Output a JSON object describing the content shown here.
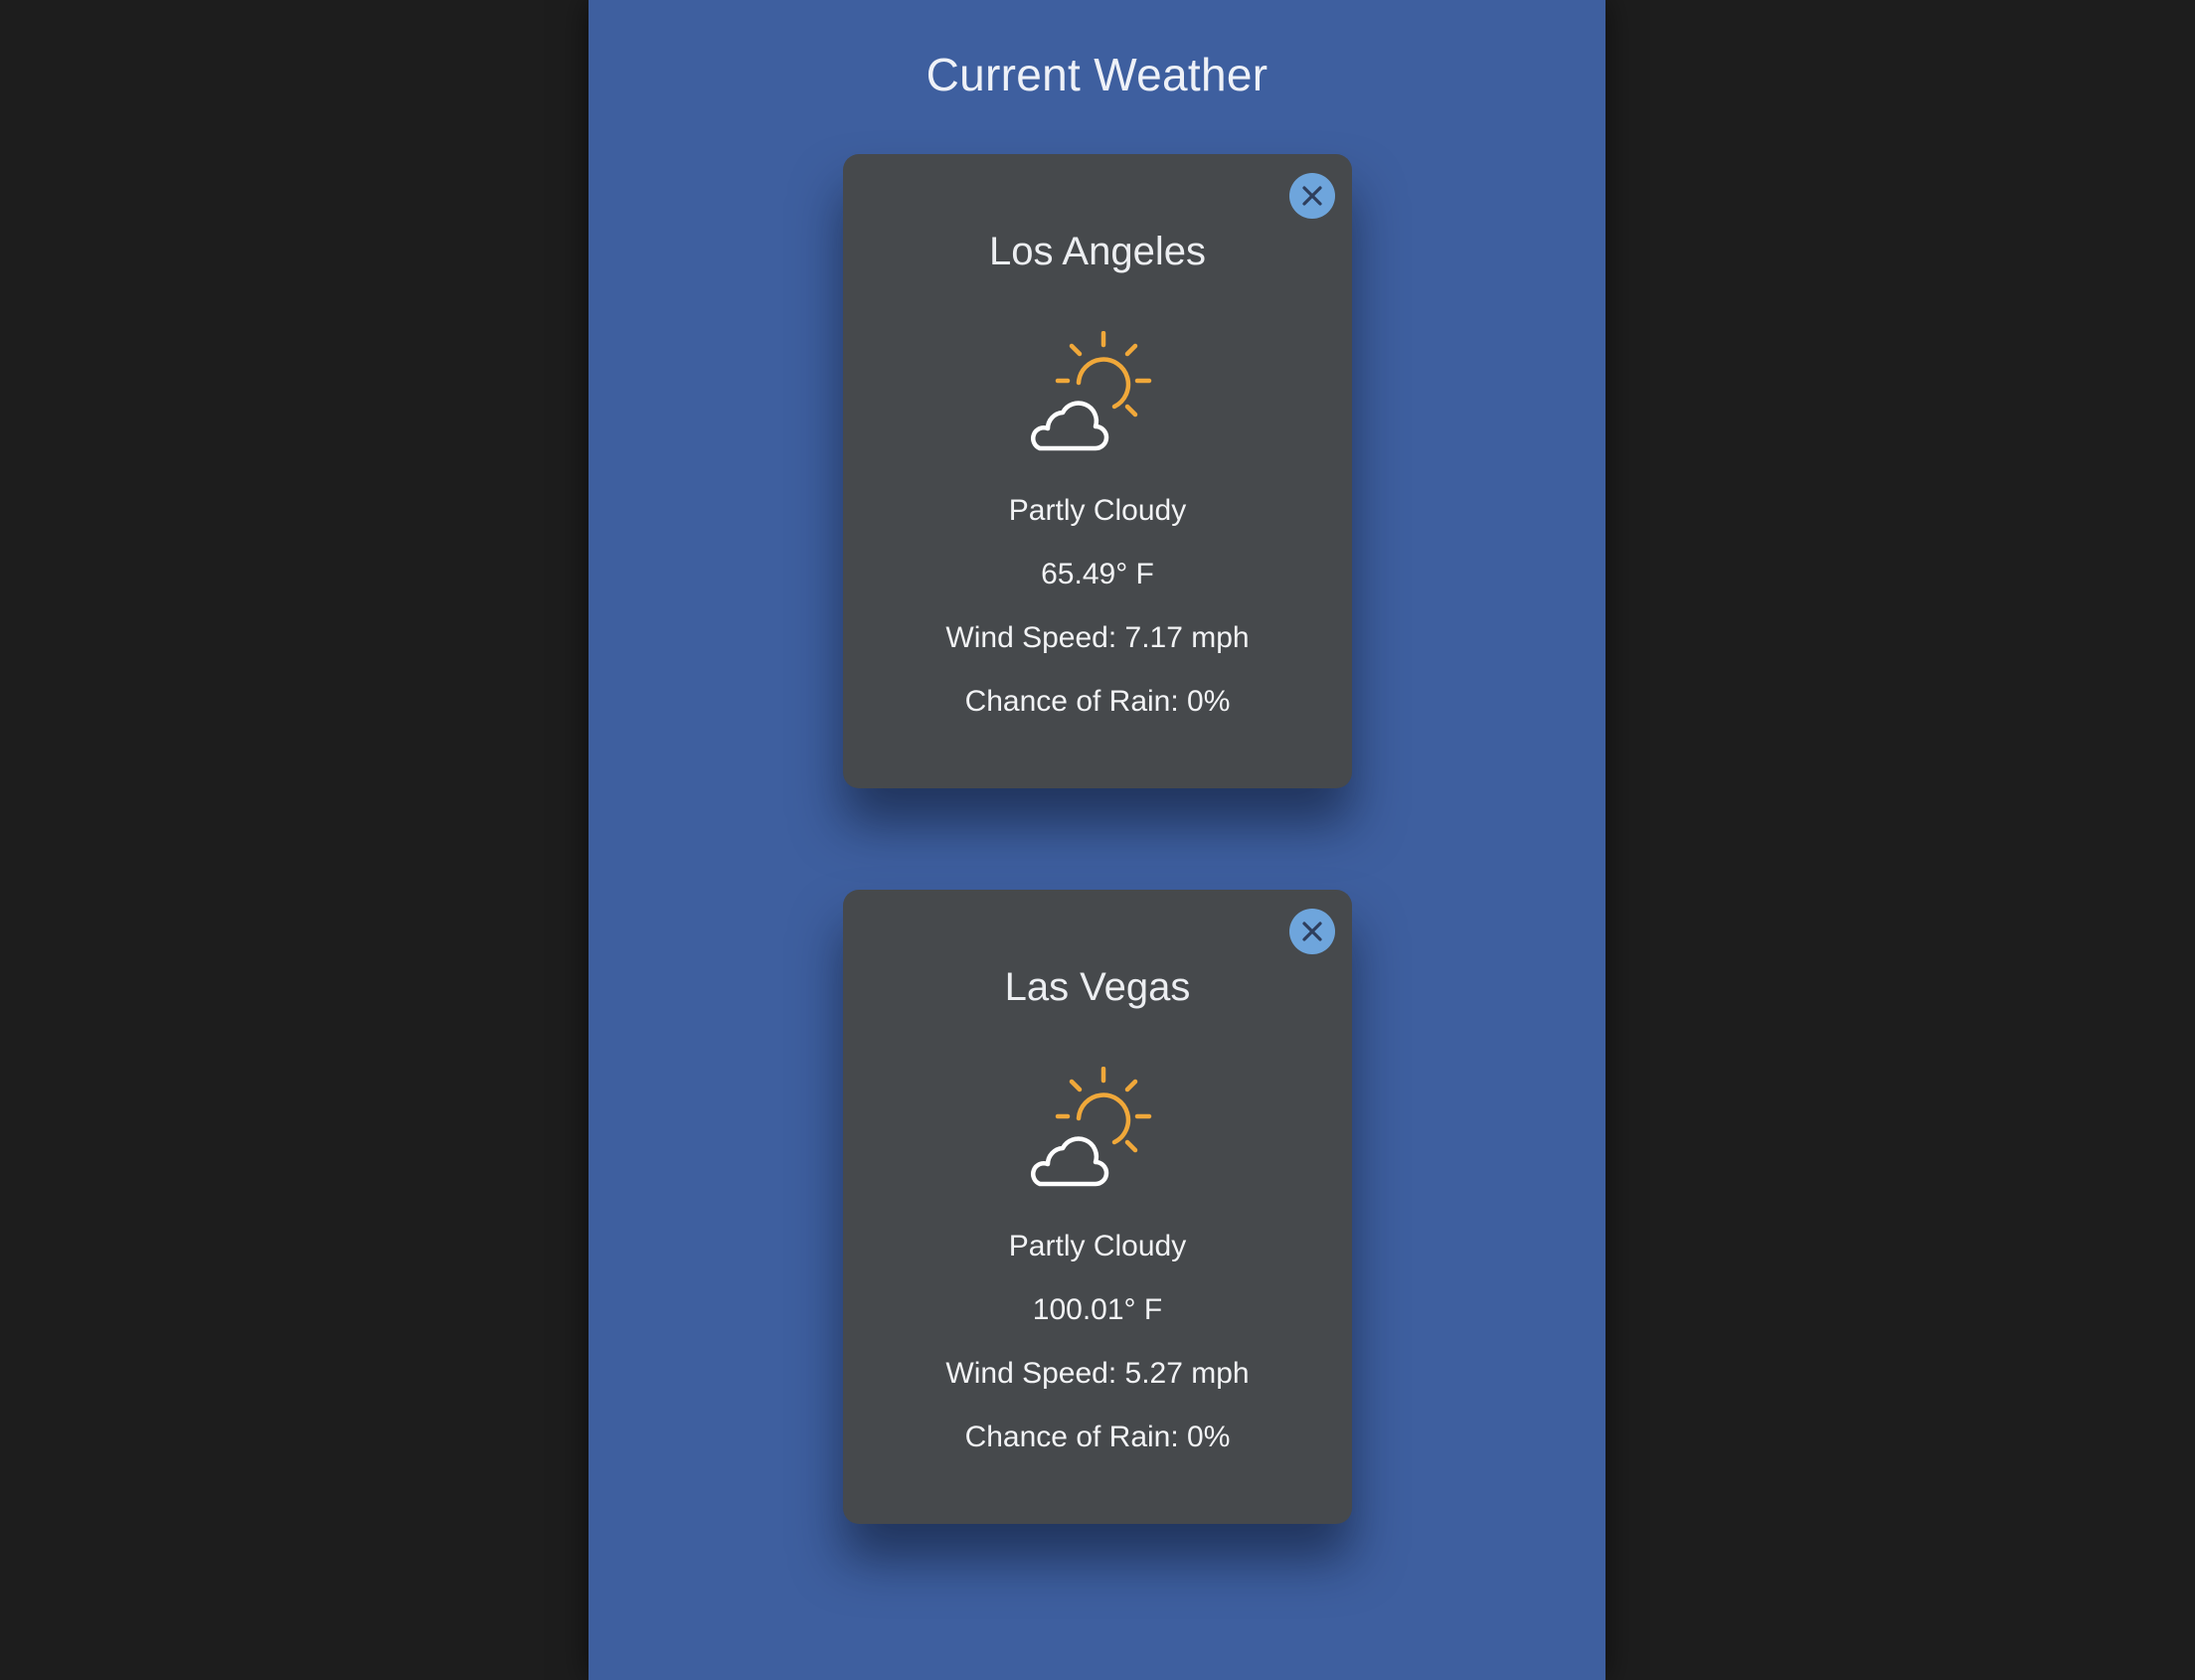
{
  "page": {
    "title": "Current Weather"
  },
  "colors": {
    "background": "#1d1d1d",
    "panel": "#3e5f9f",
    "card": "#46494c",
    "close_button": "#6ea5dc",
    "sun": "#f0a83a",
    "cloud": "#ffffff"
  },
  "cards": [
    {
      "city": "Los Angeles",
      "icon": "partly-cloudy-icon",
      "condition": "Partly Cloudy",
      "temperature": "65.49° F",
      "wind": "Wind Speed: 7.17 mph",
      "rain": "Chance of Rain: 0%"
    },
    {
      "city": "Las Vegas",
      "icon": "partly-cloudy-icon",
      "condition": "Partly Cloudy",
      "temperature": "100.01° F",
      "wind": "Wind Speed: 5.27 mph",
      "rain": "Chance of Rain: 0%"
    }
  ]
}
